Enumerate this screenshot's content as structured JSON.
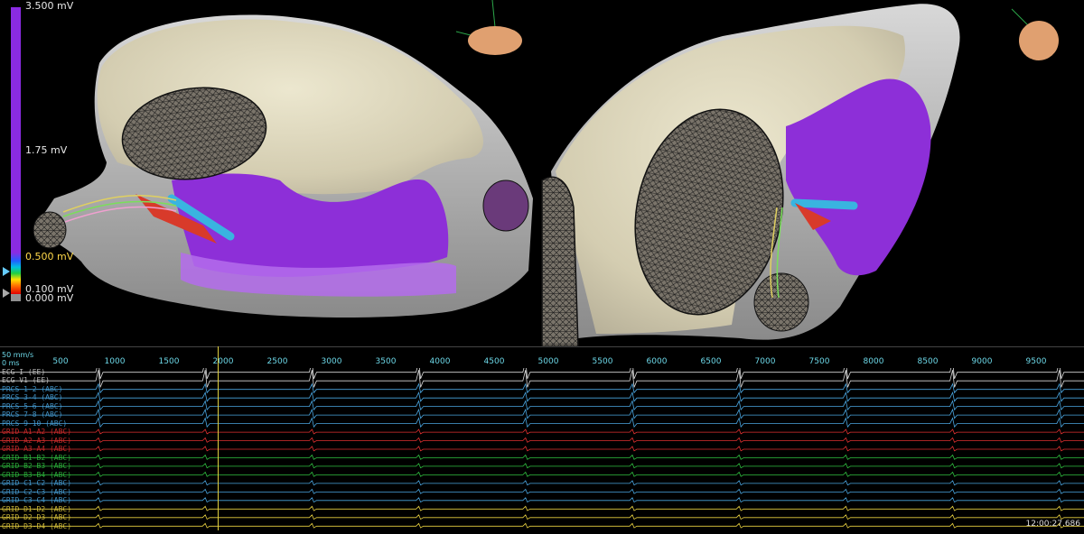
{
  "colorbar": {
    "max_label": "3.500 mV",
    "mid_label": "1.75 mV",
    "upper_threshold_label": "0.500 mV",
    "lower_threshold_label": "0.100 mV",
    "min_label": "0.000 mV",
    "colors": {
      "above": "#8a2be2",
      "low": "#909090"
    }
  },
  "viewport": {
    "views": [
      "left-view",
      "right-view"
    ],
    "orientation_icon": "head-orientation-icon"
  },
  "timeline": {
    "speed_label": "50 mm/s",
    "offset_label": "0 ms",
    "ticks": [
      "500",
      "1000",
      "1500",
      "2000",
      "2500",
      "3000",
      "3500",
      "4000",
      "4500",
      "5000",
      "5500",
      "6000",
      "6500",
      "7000",
      "7500",
      "8000",
      "8500",
      "9000",
      "9500"
    ],
    "cursor_ms": 1950,
    "timestamp": "12:00:27.686",
    "leads": [
      {
        "label": "ECG I (EE)",
        "color": "#d8d8d8"
      },
      {
        "label": "ECG V1 (EE)",
        "color": "#d8d8d8"
      },
      {
        "label": "PRCS 1-2 (ABC)",
        "color": "#4aa6e0"
      },
      {
        "label": "PRCS 3-4 (ABC)",
        "color": "#4aa6e0"
      },
      {
        "label": "PRCS 5-6 (ABC)",
        "color": "#4aa6e0"
      },
      {
        "label": "PRCS 7-8 (ABC)",
        "color": "#4aa6e0"
      },
      {
        "label": "PRCS 9-10 (ABC)",
        "color": "#4aa6e0"
      },
      {
        "label": "GRID A1-A2 (ABC)",
        "color": "#e03030"
      },
      {
        "label": "GRID A2-A3 (ABC)",
        "color": "#e03030"
      },
      {
        "label": "GRID A3-A4 (ABC)",
        "color": "#e03030"
      },
      {
        "label": "GRID B1-B2 (ABC)",
        "color": "#30c040"
      },
      {
        "label": "GRID B2-B3 (ABC)",
        "color": "#30c040"
      },
      {
        "label": "GRID B3-B4 (ABC)",
        "color": "#30c040"
      },
      {
        "label": "GRID C1-C2 (ABC)",
        "color": "#4aa6e0"
      },
      {
        "label": "GRID C2-C3 (ABC)",
        "color": "#4aa6e0"
      },
      {
        "label": "GRID C3-C4 (ABC)",
        "color": "#4aa6e0"
      },
      {
        "label": "GRID D1-D2 (ABC)",
        "color": "#e8d040"
      },
      {
        "label": "GRID D2-D3 (ABC)",
        "color": "#e8d040"
      },
      {
        "label": "GRID D3-D4 (ABC)",
        "color": "#e8d040"
      }
    ]
  }
}
